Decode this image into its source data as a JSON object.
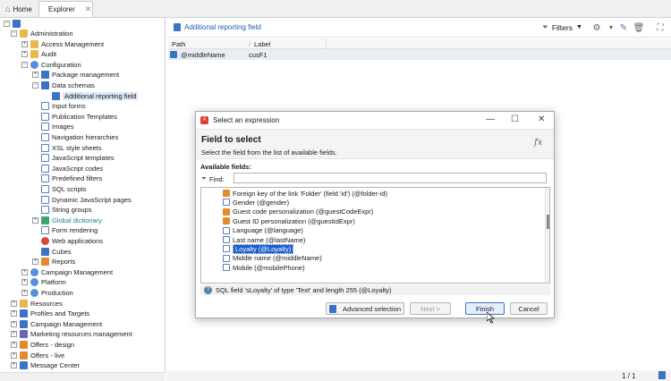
{
  "tabs": {
    "home": "Home",
    "explorer": "Explorer",
    "close": "✕"
  },
  "tree": {
    "items": [
      {
        "label": "Administration",
        "expander": "−",
        "icon": "folder-gear-icon"
      },
      {
        "label": "Access Management",
        "expander": "+",
        "icon": "folder-icon"
      },
      {
        "label": "Audit",
        "expander": "+",
        "icon": "folder-icon"
      },
      {
        "label": "Configuration",
        "expander": "−",
        "icon": "gear-icon"
      },
      {
        "label": "Package management",
        "expander": "+",
        "icon": "package-icon"
      },
      {
        "label": "Data schemas",
        "expander": "−",
        "icon": "schema-icon"
      },
      {
        "label": "Additional reporting field",
        "expander": "",
        "icon": "schema-icon"
      },
      {
        "label": "Input forms",
        "expander": "",
        "icon": "form-icon"
      },
      {
        "label": "Publication Templates",
        "expander": "",
        "icon": "template-icon"
      },
      {
        "label": "Images",
        "expander": "",
        "icon": "image-icon"
      },
      {
        "label": "Navigation hierarchies",
        "expander": "",
        "icon": "hierarchy-icon"
      },
      {
        "label": "XSL style sheets",
        "expander": "",
        "icon": "doc-icon"
      },
      {
        "label": "JavaScript templates",
        "expander": "",
        "icon": "doc-icon"
      },
      {
        "label": "JavaScript codes",
        "expander": "",
        "icon": "doc-icon"
      },
      {
        "label": "Predefined filters",
        "expander": "",
        "icon": "filter-icon"
      },
      {
        "label": "SQL scripts",
        "expander": "",
        "icon": "doc-icon"
      },
      {
        "label": "Dynamic JavaScript pages",
        "expander": "",
        "icon": "doc-icon"
      },
      {
        "label": "String groups",
        "expander": "",
        "icon": "strings-icon"
      },
      {
        "label": "Global dictionary",
        "expander": "+",
        "icon": "dictionary-icon"
      },
      {
        "label": "Form rendering",
        "expander": "",
        "icon": "form-icon"
      },
      {
        "label": "Web applications",
        "expander": "",
        "icon": "web-icon"
      },
      {
        "label": "Cubes",
        "expander": "",
        "icon": "cube-icon"
      },
      {
        "label": "Reports",
        "expander": "+",
        "icon": "report-icon"
      },
      {
        "label": "Campaign Management",
        "expander": "+",
        "icon": "gear-icon"
      },
      {
        "label": "Platform",
        "expander": "+",
        "icon": "gear-icon"
      },
      {
        "label": "Production",
        "expander": "+",
        "icon": "gear-icon"
      },
      {
        "label": "Resources",
        "expander": "+",
        "icon": "folder-icon"
      },
      {
        "label": "Profiles and Targets",
        "expander": "+",
        "icon": "people-icon"
      },
      {
        "label": "Campaign Management",
        "expander": "+",
        "icon": "campaign-icon"
      },
      {
        "label": "Marketing resources management",
        "expander": "+",
        "icon": "resources-icon"
      },
      {
        "label": "Offers - design",
        "expander": "+",
        "icon": "offers-icon"
      },
      {
        "label": "Offers - live",
        "expander": "+",
        "icon": "offers-icon"
      },
      {
        "label": "Message Center",
        "expander": "+",
        "icon": "message-icon"
      }
    ]
  },
  "header": {
    "title": "Additional reporting field",
    "filters": "Filters"
  },
  "grid": {
    "columns": [
      "Path",
      "Label"
    ],
    "rows": [
      {
        "path": "@middleName",
        "label": "cusF1"
      }
    ]
  },
  "footer": {
    "pagination": "1 / 1"
  },
  "dialog": {
    "title": "Select an expression",
    "heading": "Field to select",
    "description": "Select the field from the list of available fields.",
    "fx": "fx",
    "available_label": "Available fields:",
    "find_label": "Find:",
    "find_value": "",
    "fields": [
      {
        "label": "Foreign key of the link 'Folder' (field 'id') (@folder-id)",
        "icon": "key-field-icon"
      },
      {
        "label": "Gender (@gender)",
        "icon": "field-icon"
      },
      {
        "label": "Guest code personalization (@guestCodeExpr)",
        "icon": "key-field-icon"
      },
      {
        "label": "Guest ID personalization (@guestIdExpr)",
        "icon": "key-field-icon"
      },
      {
        "label": "Language (@language)",
        "icon": "field-icon"
      },
      {
        "label": "Last name (@lastName)",
        "icon": "field-icon"
      },
      {
        "label": "Loyalty (@Loyalty)",
        "icon": "field-icon"
      },
      {
        "label": "Middle name (@middleName)",
        "icon": "field-icon"
      },
      {
        "label": "Mobile (@mobilePhone)",
        "icon": "field-icon"
      }
    ],
    "selected_index": 6,
    "status": "SQL field 'sLoyalty' of type 'Text' and length 255 (@Loyalty)",
    "buttons": {
      "advanced": "Advanced selection",
      "next": "Next >",
      "finish": "Finish",
      "cancel": "Cancel"
    }
  },
  "colors": {
    "accent": "#1f5fae",
    "selection": "#1c5dc9",
    "teal_label": "#1e8585"
  }
}
